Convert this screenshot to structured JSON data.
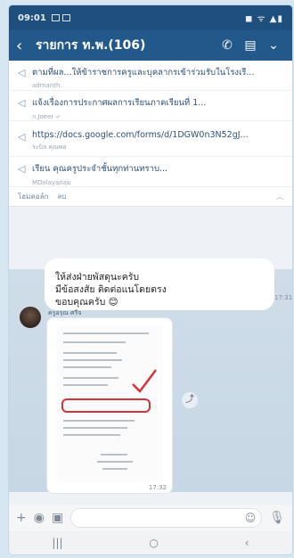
{
  "status_bar": {
    "time": "09:01",
    "right": "◼ ᯤ ▲▮"
  },
  "header": {
    "back_icon": "‹",
    "title": "รายการ ท.พ.(106)",
    "call_icon": "✆",
    "notes_icon": "▤",
    "menu_icon": "⌄"
  },
  "announcements": [
    {
      "main": "ตามที่ผล...ให้ข้าราชการครูและบุคลากรเข้าร่วมรับในโรงเรี...",
      "sub": "admanth."
    },
    {
      "main": "แจ้งเรื่องการประกาศผลการเรียนภาคเรียนที่ 1...",
      "sub": "ก.Joeer ✓"
    },
    {
      "main": "https://docs.google.com/forms/d/1DGW0n3N52gJ...",
      "sub": "ระบิล คุณพล"
    },
    {
      "main": "เรียน คุณครูประจำชั้นทุกท่านทราบ...",
      "sub": "MDolayaกลุ่ม"
    }
  ],
  "ann_footer": {
    "left": "โฮมคอล์ก",
    "middle": "ลบ",
    "chevron": "︿"
  },
  "chat": {
    "bubble_line1": "ให้ส่งฝ่ายพัสดุนะครับ",
    "bubble_line2": "มีข้อสงสัย ติดต่อแนโดยตรง",
    "bubble_line3": "ขอบคุณครับ 😊",
    "bubble_time": "17:31",
    "sender": "ครูอรุณ ศรีจ",
    "image_time": "17:32",
    "share_icon": "⤴"
  },
  "input_bar": {
    "plus_icon": "+",
    "camera_icon": "◉",
    "image_icon": "▣",
    "emoji_icon": "☺",
    "mic_icon": "🎙"
  },
  "nav": {
    "recent": "|||",
    "home": "○",
    "back": "‹"
  }
}
